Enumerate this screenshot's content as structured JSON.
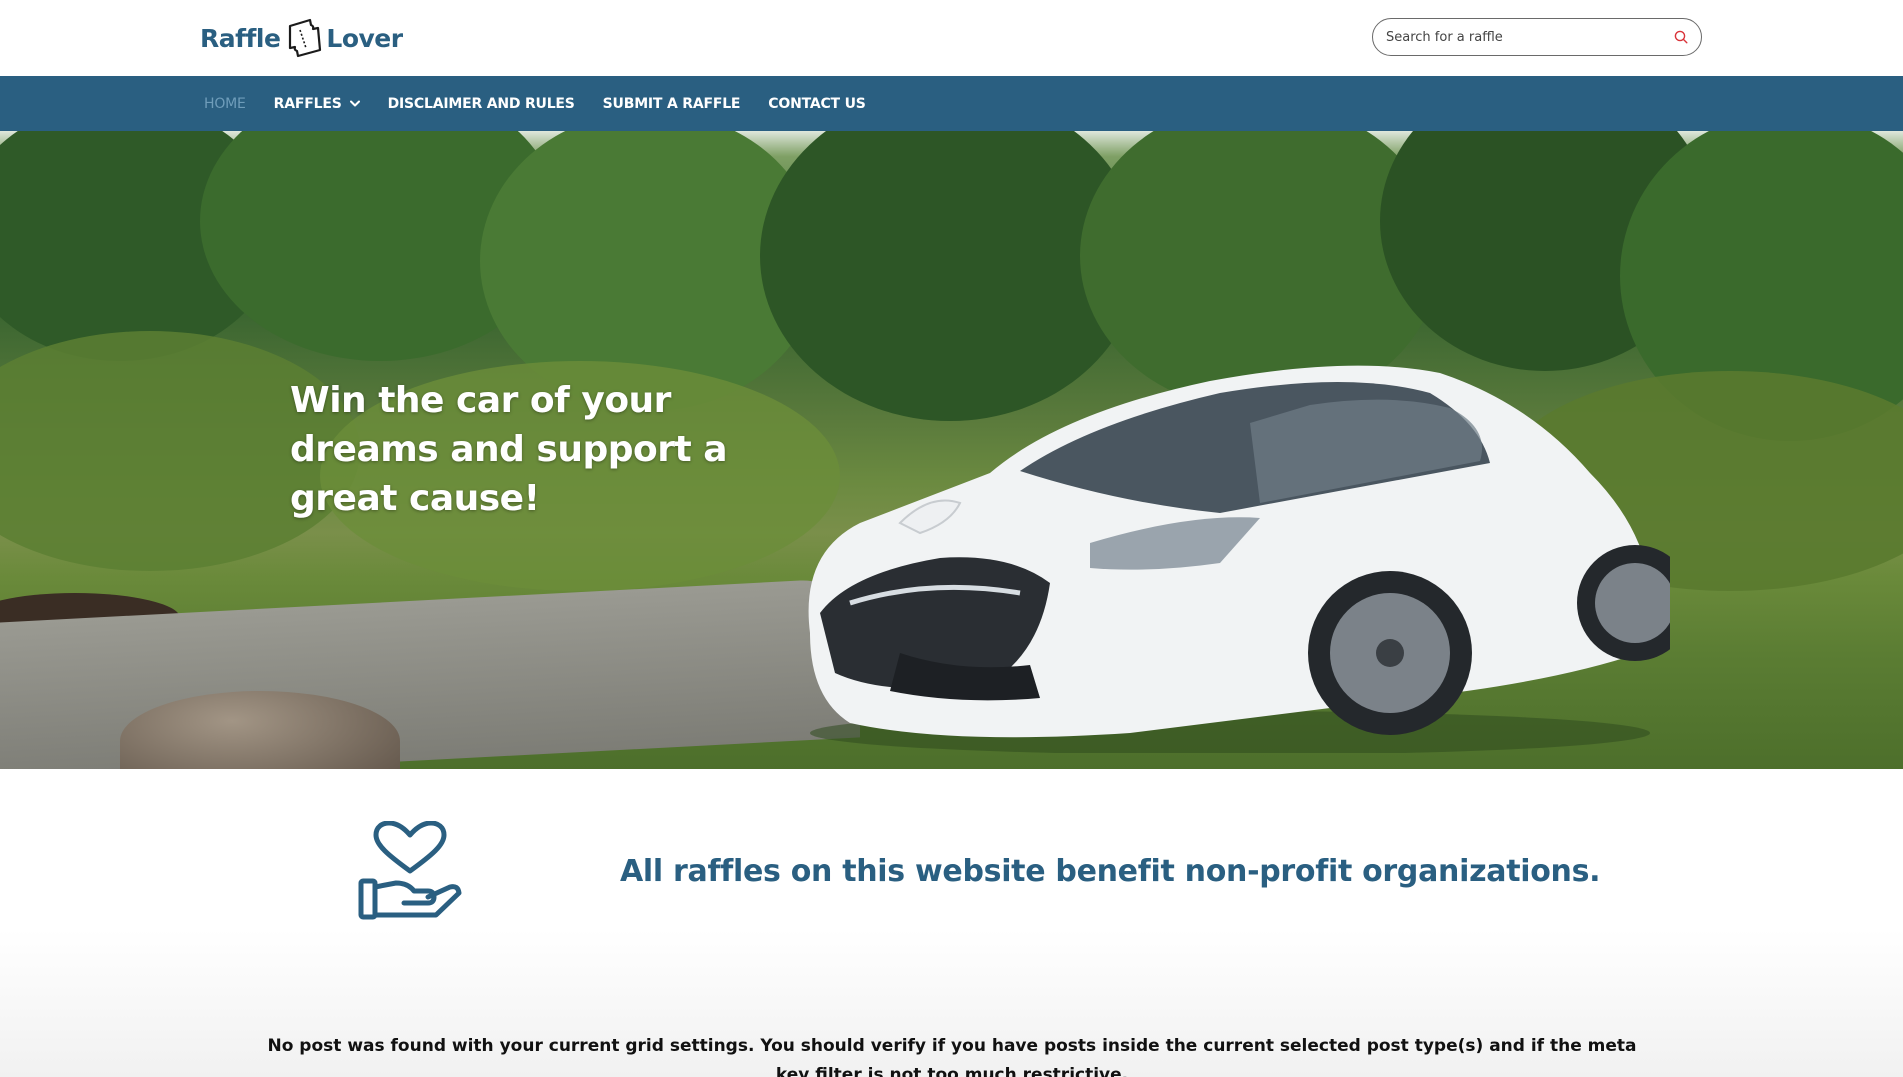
{
  "header": {
    "logo_left": "Raffle",
    "logo_right": "Lover",
    "search_placeholder": "Search for a raffle"
  },
  "nav": {
    "items": [
      {
        "label": "HOME",
        "active": true
      },
      {
        "label": "RAFFLES",
        "has_dropdown": true
      },
      {
        "label": "DISCLAIMER AND RULES"
      },
      {
        "label": "SUBMIT A RAFFLE"
      },
      {
        "label": "CONTACT US"
      }
    ]
  },
  "hero": {
    "title": "Win the car of your dreams and support a great cause!"
  },
  "benefit": {
    "icon": "heart-in-hand-icon",
    "text": "All raffles on this website benefit non-profit organizations."
  },
  "grid": {
    "message": "No post was found with your current grid settings. You should verify if you have posts inside the current selected post type(s) and if the meta key filter is not too much restrictive."
  },
  "colors": {
    "brand": "#2a5f81",
    "nav_active": "#6f9dba",
    "search_icon": "#d9343a"
  }
}
